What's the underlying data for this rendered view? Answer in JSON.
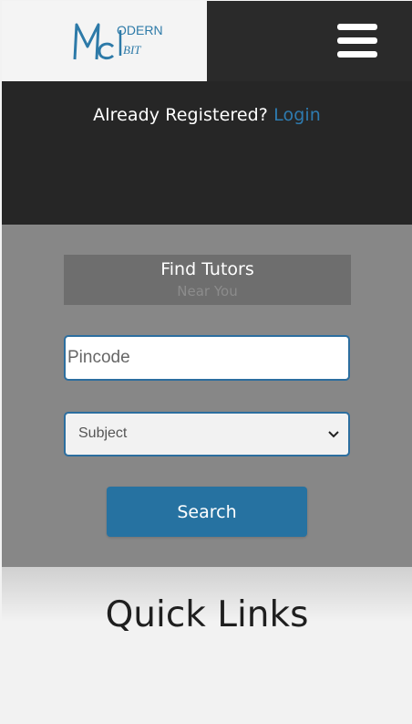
{
  "header": {
    "logo": {
      "initials": "Mc",
      "line1": "ODERN",
      "line2": "BIT",
      "color": "#2d7aa8"
    },
    "menu_icon": "hamburger-icon"
  },
  "auth": {
    "prompt": "Already Registered?",
    "login_label": "Login"
  },
  "finder": {
    "title": "Find Tutors",
    "subtitle": "Near You",
    "pincode_placeholder": "Pincode",
    "subject_selected": "Subject",
    "subject_icon": "chevron-down-icon",
    "search_label": "Search"
  },
  "quick_links": {
    "title": "Quick Links"
  },
  "colors": {
    "accent": "#2672a1",
    "link": "#2e7bb0",
    "header_bg": "#2a2a2a",
    "panel_bg": "#878787"
  }
}
